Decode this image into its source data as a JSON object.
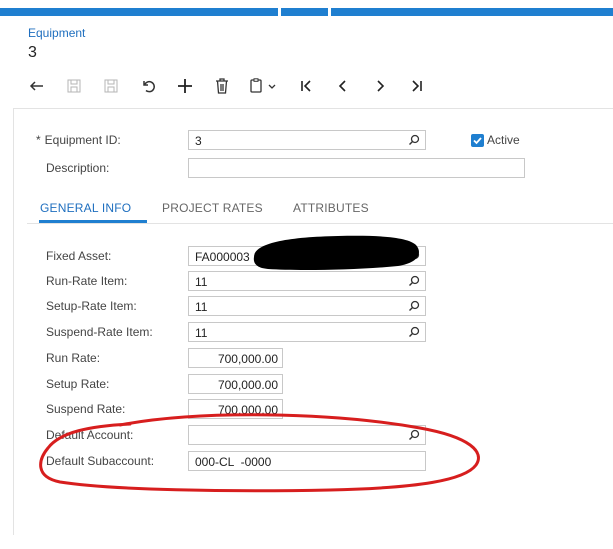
{
  "breadcrumb": "Equipment",
  "title": "3",
  "toolbar": {
    "items": [
      "back-icon",
      "save-icon",
      "save-close-icon",
      "undo-icon",
      "add-icon",
      "delete-icon",
      "copy-paste-icon",
      "first-icon",
      "previous-icon",
      "next-icon",
      "last-icon"
    ]
  },
  "header": {
    "equipment_id_label": "Equipment ID:",
    "required_mark": "*",
    "equipment_id_value": "3",
    "active_label": "Active",
    "description_label": "Description:",
    "description_value": ""
  },
  "tabs": [
    {
      "label": "GENERAL INFO",
      "active": true
    },
    {
      "label": "PROJECT RATES",
      "active": false
    },
    {
      "label": "ATTRIBUTES",
      "active": false
    }
  ],
  "general": {
    "fixed_asset_label": "Fixed Asset:",
    "fixed_asset_value": "FA000003",
    "run_rate_item_label": "Run-Rate Item:",
    "run_rate_item_value": "11",
    "setup_rate_item_label": "Setup-Rate Item:",
    "setup_rate_item_value": "11",
    "suspend_rate_item_label": "Suspend-Rate Item:",
    "suspend_rate_item_value": "11",
    "run_rate_label": "Run Rate:",
    "run_rate_value": "700,000.00",
    "setup_rate_label": "Setup Rate:",
    "setup_rate_value": "700,000.00",
    "suspend_rate_label": "Suspend Rate:",
    "suspend_rate_value": "700,000.00",
    "default_account_label": "Default Account:",
    "default_account_value": "",
    "default_subaccount_label": "Default Subaccount:",
    "default_subaccount_value": "000-CL  -0000"
  },
  "colors": {
    "accent": "#1f7fd0",
    "annotation": "#d71e1e",
    "redaction": "#000000"
  }
}
